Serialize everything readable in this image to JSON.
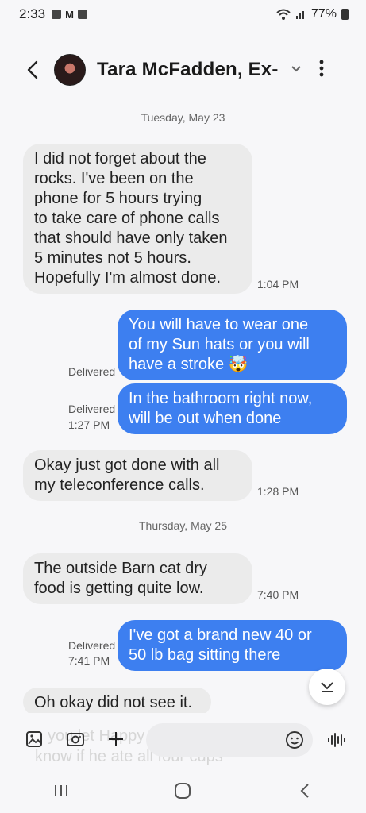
{
  "status": {
    "time": "2:33",
    "battery": "77%"
  },
  "header": {
    "contact_name": "Tara McFadden, Ex-..."
  },
  "dates": [
    "Tuesday, May 23",
    "Thursday, May 25"
  ],
  "messages": [
    {
      "dir": "in",
      "lines": [
        "I did not forget about the",
        "rocks. I've been on the",
        "phone for 5 hours trying",
        "to take care of phone calls",
        "that should have only taken",
        "5 minutes not 5 hours.",
        "Hopefully I'm almost done."
      ],
      "time": "1:04 PM"
    },
    {
      "dir": "out",
      "lines": [
        "You will have to wear one",
        "of my Sun hats or you will",
        "have a stroke  🤯"
      ],
      "status": "Delivered"
    },
    {
      "dir": "out",
      "lines": [
        "In the bathroom right now,",
        "will be out when done"
      ],
      "status": "Delivered",
      "time": "1:27 PM"
    },
    {
      "dir": "in",
      "lines": [
        "Okay just got done with all",
        "my teleconference calls."
      ],
      "time": "1:28 PM"
    },
    {
      "dir": "in",
      "lines": [
        "The outside Barn cat dry",
        "food is getting quite low."
      ],
      "time": "7:40 PM"
    },
    {
      "dir": "out",
      "lines": [
        "I've got a brand new 40 or",
        "50 lb bag sitting there"
      ],
      "status": "Delivered",
      "time": "7:41 PM"
    },
    {
      "dir": "in",
      "lines": [
        "Oh okay did not see it."
      ]
    }
  ],
  "composer": {
    "ghost_lines": [
      "you let Happy",
      "know if he ate all four cups"
    ]
  },
  "icons": [
    "back-icon",
    "chevron-down-icon",
    "more-vert-icon",
    "scroll-down-icon",
    "gallery-icon",
    "camera-icon",
    "plus-icon",
    "emoji-icon",
    "voice-icon",
    "recents-icon",
    "home-icon",
    "nav-back-icon"
  ],
  "colors": {
    "outgoing": "#3d7ff0",
    "incoming": "#ebebeb",
    "background": "#f7f7f9"
  }
}
